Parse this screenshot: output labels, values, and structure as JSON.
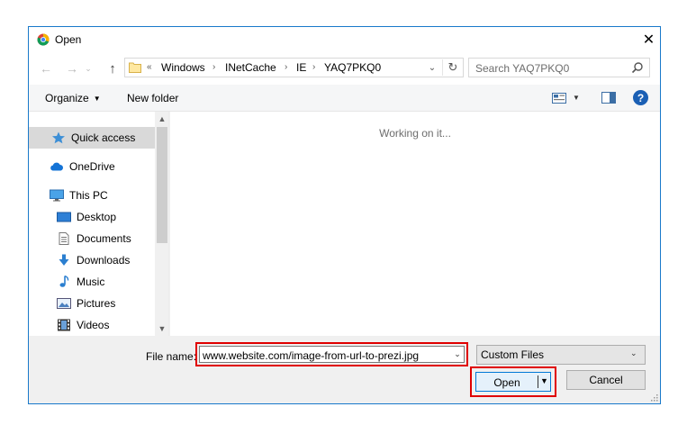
{
  "window": {
    "title": "Open",
    "close_glyph": "✕"
  },
  "nav": {
    "back_glyph": "←",
    "forward_glyph": "→",
    "recent_glyph": "⌄",
    "up_glyph": "↑",
    "breadcrumb_prefix": "«",
    "breadcrumbs": [
      "Windows",
      "INetCache",
      "IE",
      "YAQ7PKQ0"
    ],
    "separator": "›",
    "refresh_glyph": "↻",
    "dropdown_glyph": "⌄"
  },
  "search": {
    "placeholder": "Search YAQ7PKQ0"
  },
  "toolbar": {
    "organize_label": "Organize",
    "new_folder_label": "New folder",
    "help_glyph": "?",
    "caret_glyph": "▼"
  },
  "sidebar": {
    "items": [
      {
        "label": "Quick access",
        "icon": "star-icon"
      },
      {
        "label": "OneDrive",
        "icon": "cloud-icon"
      },
      {
        "label": "This PC",
        "icon": "computer-icon"
      },
      {
        "label": "Desktop",
        "icon": "desktop-icon"
      },
      {
        "label": "Documents",
        "icon": "documents-icon"
      },
      {
        "label": "Downloads",
        "icon": "download-icon"
      },
      {
        "label": "Music",
        "icon": "music-icon"
      },
      {
        "label": "Pictures",
        "icon": "pictures-icon"
      },
      {
        "label": "Videos",
        "icon": "videos-icon"
      }
    ],
    "scroll_up_glyph": "▲",
    "scroll_down_glyph": "▼"
  },
  "content": {
    "status_text": "Working on it..."
  },
  "bottom": {
    "file_name_label": "File name:",
    "file_name_value": "www.website.com/image-from-url-to-prezi.jpg",
    "file_type_value": "Custom Files",
    "open_label": "Open",
    "cancel_label": "Cancel",
    "dropdown_glyph": "▼"
  },
  "colors": {
    "accent": "#1979ca",
    "highlight_outline": "#e00000",
    "selected_item": "#d9d9d9"
  }
}
